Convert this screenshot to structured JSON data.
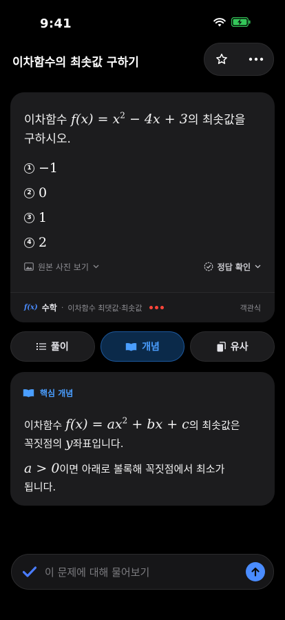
{
  "status": {
    "time": "9:41"
  },
  "header": {
    "title": "이차함수의 최솟값 구하기"
  },
  "problem": {
    "prefix": "이차함수",
    "suffix_1": "의 최솟값을",
    "suffix_2": "구하시오.",
    "equation": "f(x) = x² − 4x + 3",
    "choices": [
      {
        "marker": "1",
        "value": "−1"
      },
      {
        "marker": "2",
        "value": "0"
      },
      {
        "marker": "3",
        "value": "1"
      },
      {
        "marker": "4",
        "value": "2"
      }
    ],
    "view_original": "원본 사진 보기",
    "check_answer": "정답 확인",
    "footer": {
      "badge": "f(x)",
      "subject": "수학",
      "topic": "이차함수 최댓값·최솟값",
      "type": "객관식"
    }
  },
  "tabs": [
    {
      "label": "풀이",
      "icon": "list-icon"
    },
    {
      "label": "개념",
      "icon": "book-icon",
      "active": true
    },
    {
      "label": "유사",
      "icon": "copy-icon"
    }
  ],
  "concept": {
    "header": "핵심 개념",
    "line1_prefix": "이차함수",
    "line1_eq": "f(x) = ax² + bx + c",
    "line1_suffix": "의 최솟값은",
    "line2_prefix": "꼭짓점의",
    "line2_var": "y",
    "line2_suffix": "좌표입니다.",
    "line3_cond": "a > 0",
    "line3_suffix": "이면 아래로 볼록해 꼭짓점에서 최소가",
    "line4": "됩니다."
  },
  "input": {
    "placeholder": "이 문제에 대해 물어보기"
  },
  "colors": {
    "accent": "#4a9eff",
    "background": "#000000",
    "card": "#1c1c1e",
    "battery": "#34c759",
    "alert": "#ff453a"
  }
}
